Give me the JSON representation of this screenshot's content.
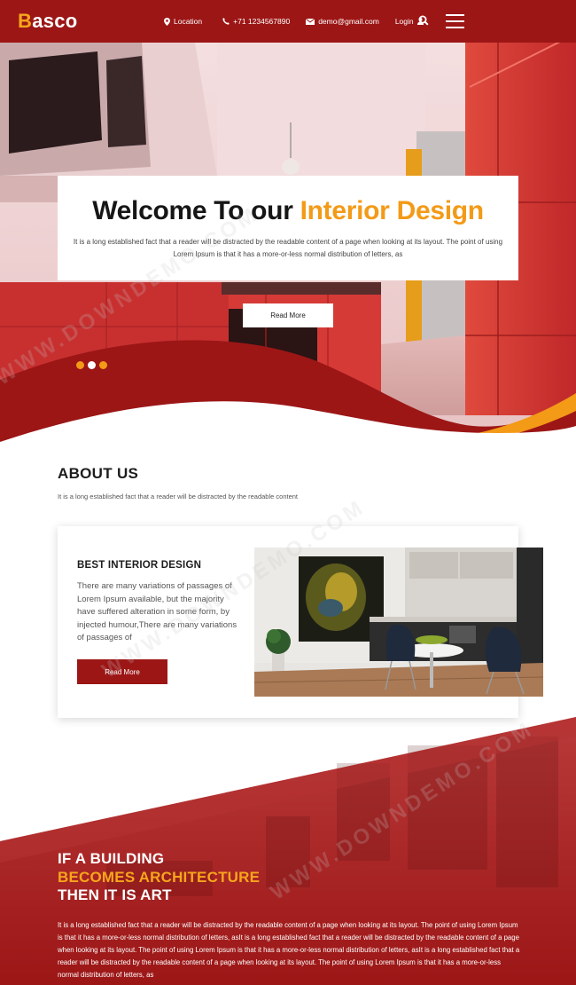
{
  "header": {
    "logo_first": "B",
    "logo_rest": "asco",
    "location_label": "Location",
    "phone_label": "+71 1234567890",
    "email_label": "demo@gmail.com",
    "login_label": "Login"
  },
  "hero": {
    "title_prefix": "Welcome To our ",
    "title_highlight": "Interior Design",
    "text": "It is a long established fact that a reader will be distracted by the readable content of a page when looking at its layout. The point of using Lorem Ipsum is that it has a more-or-less normal distribution of letters, as",
    "button_label": "Read More",
    "slide_count": 3,
    "active_slide": 2
  },
  "about": {
    "title": "ABOUT US",
    "subtitle": "It is a long established fact that a reader will be distracted by the readable content",
    "card_title": "BEST INTERIOR DESIGN",
    "card_text": "There are many variations of passages of Lorem Ipsum available, but the majority have suffered alteration in some form, by injected humour,There are many variations of passages of",
    "card_button_label": "Read More"
  },
  "art": {
    "title_line1": "IF A BUILDING",
    "title_line2": "BECOMES ARCHITECTURE",
    "title_line3": "THEN IT IS ART",
    "text": "It is a long established fact that a reader will be distracted by the readable content of a page when looking at its layout. The point of using Lorem Ipsum is that it has a more-or-less normal distribution of letters, asIt is a long established fact that a reader will be distracted by the readable content of a page when looking at its layout. The point of using Lorem Ipsum is that it has a more-or-less normal distribution of letters, asIt is a long established fact that a reader will be distracted by the readable content of a page when looking at its layout. The point of using Lorem Ipsum is that it has a more-or-less normal distribution of letters, as"
  },
  "watermark": "WWW.DOWNDEMO.COM",
  "colors": {
    "brand_red": "#9c1616",
    "accent_orange": "#f39a17",
    "white": "#ffffff"
  },
  "icons": [
    "location-pin-icon",
    "phone-icon",
    "email-icon",
    "user-icon",
    "search-icon",
    "hamburger-menu-icon"
  ]
}
